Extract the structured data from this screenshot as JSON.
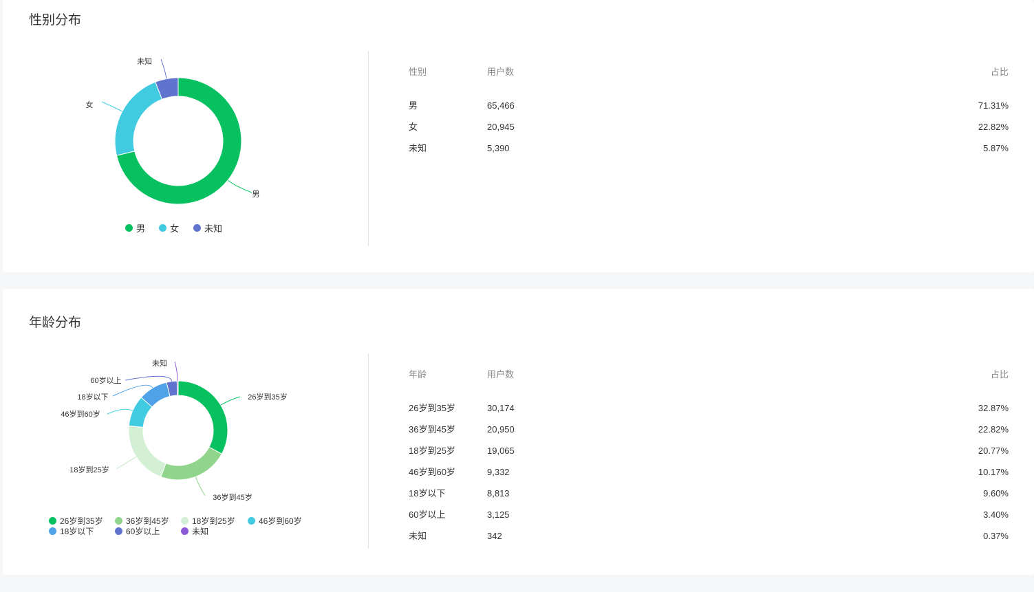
{
  "gender": {
    "title": "性别分布",
    "table_headers": [
      "性别",
      "用户数",
      "占比"
    ],
    "rows": [
      {
        "label": "男",
        "count": "65,466",
        "pct": "71.31%",
        "value": 65466,
        "color": "#07c160"
      },
      {
        "label": "女",
        "count": "20,945",
        "pct": "22.82%",
        "value": 20945,
        "color": "#40cbe0"
      },
      {
        "label": "未知",
        "count": "5,390",
        "pct": "5.87%",
        "value": 5390,
        "color": "#5f73cf"
      }
    ]
  },
  "age": {
    "title": "年龄分布",
    "table_headers": [
      "年龄",
      "用户数",
      "占比"
    ],
    "rows": [
      {
        "label": "26岁到35岁",
        "count": "30,174",
        "pct": "32.87%",
        "value": 30174,
        "color": "#07c160"
      },
      {
        "label": "36岁到45岁",
        "count": "20,950",
        "pct": "22.82%",
        "value": 20950,
        "color": "#91d48b"
      },
      {
        "label": "18岁到25岁",
        "count": "19,065",
        "pct": "20.77%",
        "value": 19065,
        "color": "#d3efd4"
      },
      {
        "label": "46岁到60岁",
        "count": "9,332",
        "pct": "10.17%",
        "value": 9332,
        "color": "#40cbe0"
      },
      {
        "label": "18岁以下",
        "count": "8,813",
        "pct": "9.60%",
        "value": 8813,
        "color": "#4fa2e8"
      },
      {
        "label": "60岁以上",
        "count": "3,125",
        "pct": "3.40%",
        "value": 3125,
        "color": "#5f73cf"
      },
      {
        "label": "未知",
        "count": "342",
        "pct": "0.37%",
        "value": 342,
        "color": "#8c5ad8"
      }
    ]
  }
}
